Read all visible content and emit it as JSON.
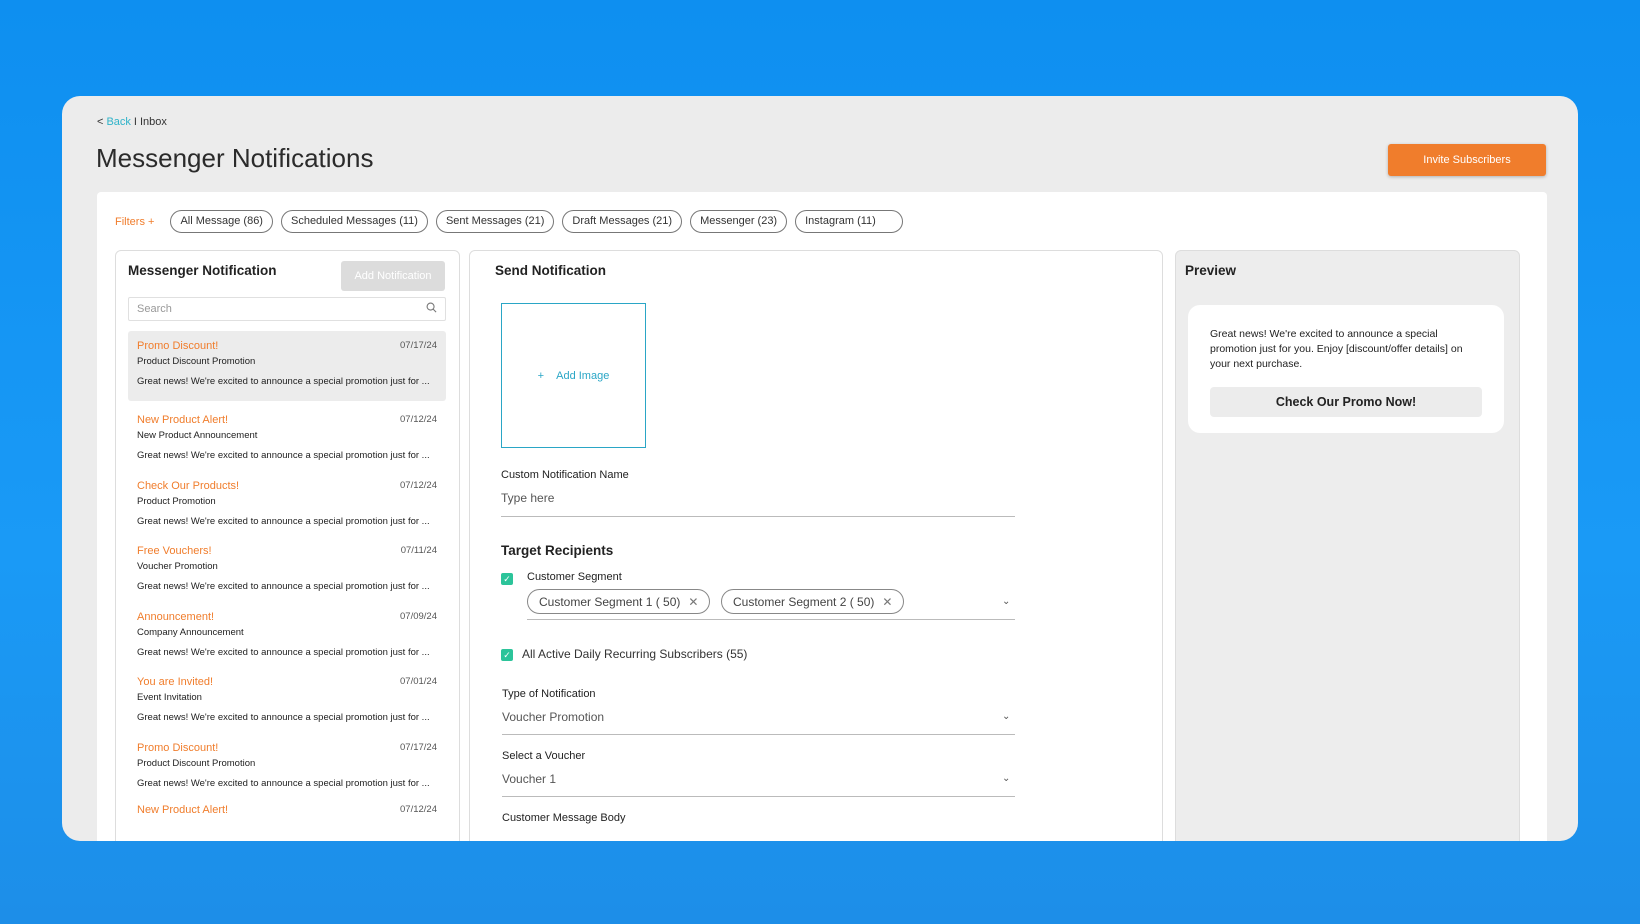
{
  "breadcrumb": {
    "lt": "<",
    "back": "Back",
    "sep": "I",
    "current": "Inbox"
  },
  "page": {
    "title": "Messenger Notifications",
    "invite_label": "Invite Subscribers"
  },
  "filters": {
    "label": "Filters +",
    "chips": [
      "All Message (86)",
      "Scheduled Messages (11)",
      "Sent Messages (21)",
      "Draft Messages (21)",
      "Messenger (23)",
      "Instagram (11)"
    ]
  },
  "left": {
    "title": "Messenger Notification",
    "add_label": "Add Notification",
    "search_placeholder": "Search",
    "items": [
      {
        "title": "Promo Discount!",
        "subtitle": "Product Discount Promotion",
        "date": "07/17/24",
        "desc": "Great news! We're excited to announce a special promotion just for ..."
      },
      {
        "title": "New Product Alert!",
        "subtitle": "New Product Announcement",
        "date": "07/12/24",
        "desc": "Great news! We're excited to announce a special promotion just for ..."
      },
      {
        "title": "Check Our Products!",
        "subtitle": "Product Promotion",
        "date": "07/12/24",
        "desc": "Great news! We're excited to announce a special promotion just for ..."
      },
      {
        "title": "Free Vouchers!",
        "subtitle": "Voucher Promotion",
        "date": "07/11/24",
        "desc": "Great news! We're excited to announce a special promotion just for ..."
      },
      {
        "title": "Announcement!",
        "subtitle": "Company Announcement",
        "date": "07/09/24",
        "desc": "Great news! We're excited to announce a special promotion just for ..."
      },
      {
        "title": "You are Invited!",
        "subtitle": "Event Invitation",
        "date": "07/01/24",
        "desc": "Great news! We're excited to announce a special promotion just for ..."
      },
      {
        "title": "Promo Discount!",
        "subtitle": "Product Discount Promotion",
        "date": "07/17/24",
        "desc": "Great news! We're excited to announce a special promotion just for ..."
      },
      {
        "title": "New Product Alert!",
        "subtitle": "",
        "date": "07/12/24",
        "desc": ""
      }
    ]
  },
  "send": {
    "title": "Send Notification",
    "add_image": "Add Image",
    "custom_name_label": "Custom Notification Name",
    "custom_name_placeholder": "Type here",
    "target_title": "Target Recipients",
    "segment_label": "Customer Segment",
    "segments": [
      "Customer Segment 1  ( 50)",
      "Customer Segment 2  ( 50)"
    ],
    "subscribers_label": "All Active Daily Recurring Subscribers (55)",
    "type_label": "Type of Notification",
    "type_value": "Voucher Promotion",
    "voucher_label": "Select a Voucher",
    "voucher_value": "Voucher 1",
    "body_label": "Customer Message Body"
  },
  "preview": {
    "title": "Preview",
    "text": "Great news! We're excited to announce a special promotion just for you. Enjoy [discount/offer details] on your next purchase.",
    "button": "Check Our Promo Now!"
  },
  "colors": {
    "accent": "#f07d2c",
    "link": "#2fb3c9",
    "check": "#2cc49a",
    "background": "#1a9af6"
  }
}
